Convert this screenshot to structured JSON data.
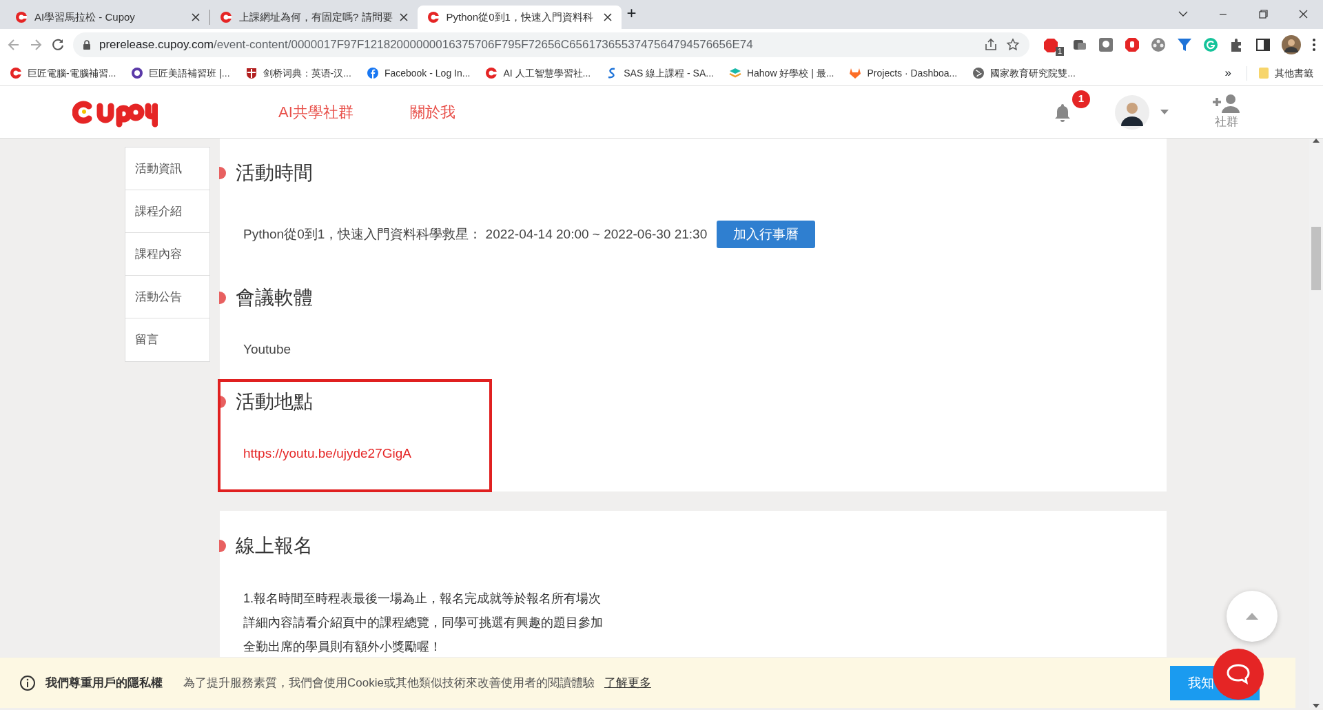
{
  "browser": {
    "tabs": [
      {
        "title": "AI學習馬拉松 - Cupoy",
        "selected": false
      },
      {
        "title": "上課網址為何，有固定嗎? 請問要",
        "selected": false
      },
      {
        "title": "Python從0到1，快速入門資料科",
        "selected": true
      }
    ],
    "new_tab": "+",
    "address": {
      "host": "prerelease.cupoy.com",
      "path": "/event-content/0000017F97F12182000000016375706F795F72656C6561736553747564794576656E74"
    },
    "extension_badge": "1",
    "bookmarks": [
      {
        "label": "巨匠電腦-電腦補習..."
      },
      {
        "label": "巨匠美語補習班 |..."
      },
      {
        "label": "剑桥词典：英语-汉..."
      },
      {
        "label": "Facebook - Log In..."
      },
      {
        "label": "AI 人工智慧學習社..."
      },
      {
        "label": "SAS 線上課程 - SA..."
      },
      {
        "label": "Hahow 好學校 | 最..."
      },
      {
        "label": "Projects · Dashboa..."
      },
      {
        "label": "國家教育研究院雙..."
      }
    ],
    "bookmarks_overflow": "»",
    "other_bookmarks": "其他書籤"
  },
  "site_header": {
    "nav": [
      {
        "label": "AI共學社群"
      },
      {
        "label": "關於我"
      }
    ],
    "notification_count": "1",
    "community_label": "社群"
  },
  "sidebar": {
    "items": [
      {
        "label": "活動資訊"
      },
      {
        "label": "課程介紹"
      },
      {
        "label": "課程內容"
      },
      {
        "label": "活動公告"
      },
      {
        "label": "留言"
      }
    ]
  },
  "sections": [
    {
      "kind": "schedule",
      "heading": "活動時間",
      "text": "Python從0到1，快速入門資料科學救星： 2022-04-14 20:00 ~ 2022-06-30 21:30",
      "button": "加入行事曆",
      "highlighted": false
    },
    {
      "kind": "text",
      "heading": "會議軟體",
      "text": "Youtube",
      "highlighted": false
    },
    {
      "kind": "link",
      "heading": "活動地點",
      "text": "https://youtu.be/ujyde27GigA",
      "highlighted": true
    }
  ],
  "signup": {
    "heading": "線上報名",
    "lines": [
      "1.報名時間至時程表最後一場為止，報名完成就等於報名所有場次",
      "詳細內容請看介紹頁中的課程總覽，同學可挑選有興趣的題目參加",
      "全勤出席的學員則有額外小獎勵喔！"
    ]
  },
  "cookie_bar": {
    "title": "我們尊重用戶的隱私權",
    "text": "為了提升服務素質，我們會使用Cookie或其他類似技術來改善使用者的閱讀體驗",
    "link": "了解更多",
    "button": "我知"
  }
}
